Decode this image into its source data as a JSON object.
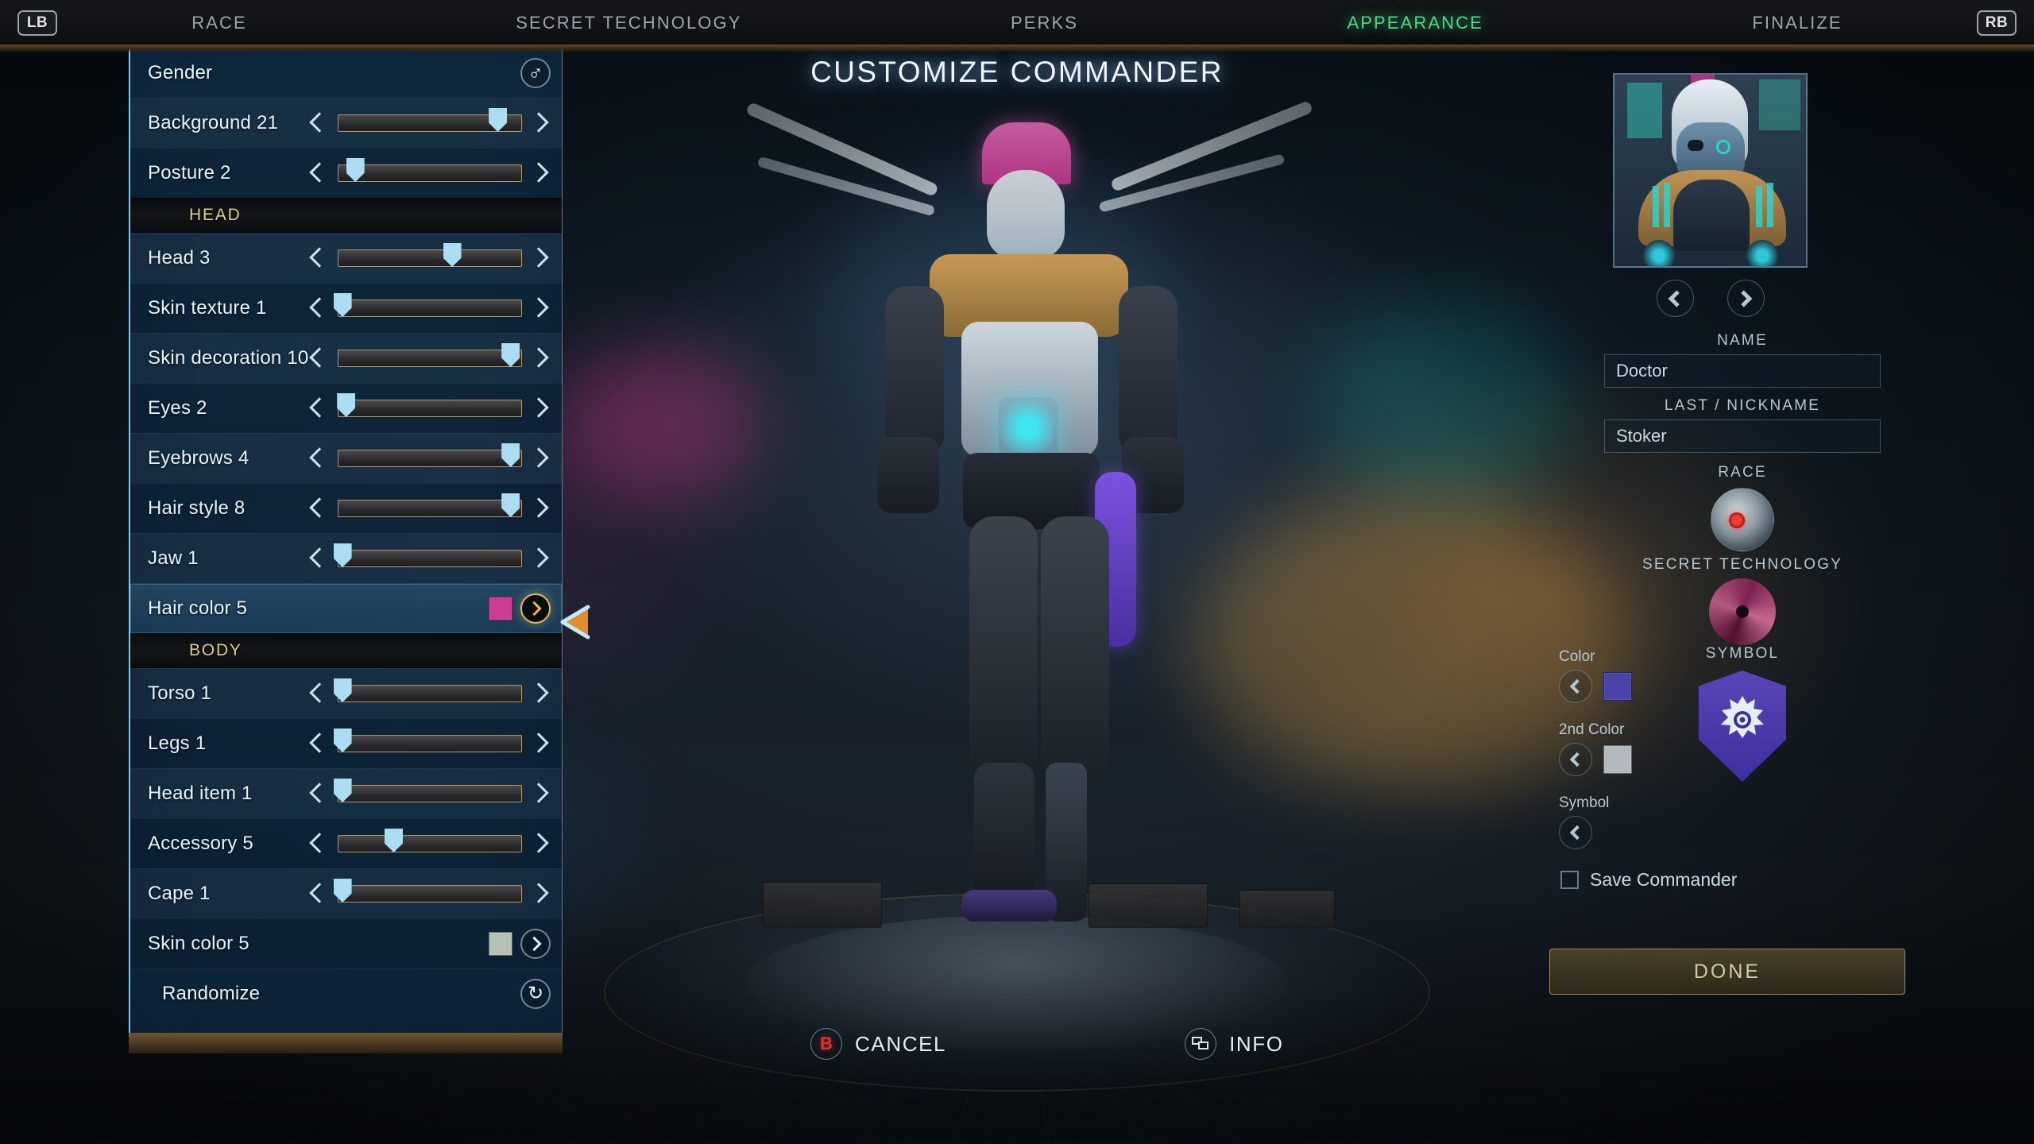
{
  "topbar": {
    "left_bumper": "LB",
    "right_bumper": "RB",
    "tabs": [
      {
        "label": "RACE",
        "active": false
      },
      {
        "label": "SECRET TECHNOLOGY",
        "active": false
      },
      {
        "label": "PERKS",
        "active": false
      },
      {
        "label": "APPEARANCE",
        "active": true
      },
      {
        "label": "FINALIZE",
        "active": false
      }
    ],
    "active_tab_color": "#4fd98a"
  },
  "page_title": "CUSTOMIZE COMMANDER",
  "sidebar": {
    "gender_row": {
      "label": "Gender",
      "icon": "male-gender-icon",
      "glyph": "♂"
    },
    "rows": [
      {
        "label": "Background 21",
        "type": "slider",
        "value": 0.87
      },
      {
        "label": "Posture 2",
        "type": "slider",
        "value": 0.09
      },
      {
        "label": "HEAD",
        "type": "section"
      },
      {
        "label": "Head 3",
        "type": "slider",
        "value": 0.62
      },
      {
        "label": "Skin texture 1",
        "type": "slider",
        "value": 0.02
      },
      {
        "label": "Skin decoration 10",
        "type": "slider",
        "value": 0.94
      },
      {
        "label": "Eyes 2",
        "type": "slider",
        "value": 0.04
      },
      {
        "label": "Eyebrows 4",
        "type": "slider",
        "value": 0.94
      },
      {
        "label": "Hair style 8",
        "type": "slider",
        "value": 0.94
      },
      {
        "label": "Jaw 1",
        "type": "slider",
        "value": 0.02
      },
      {
        "label": "Hair color 5",
        "type": "color",
        "color": "#cc3d93",
        "selected": true
      },
      {
        "label": "BODY",
        "type": "section"
      },
      {
        "label": "Torso 1",
        "type": "slider",
        "value": 0.02
      },
      {
        "label": "Legs 1",
        "type": "slider",
        "value": 0.02
      },
      {
        "label": "Head item 1",
        "type": "slider",
        "value": 0.02
      },
      {
        "label": "Accessory 5",
        "type": "slider",
        "value": 0.3
      },
      {
        "label": "Cape 1",
        "type": "slider",
        "value": 0.02
      },
      {
        "label": "Skin color 5",
        "type": "color",
        "color": "#b8c2b4"
      }
    ],
    "randomize": {
      "label": "Randomize",
      "icon": "recycle-icon",
      "glyph": "↻"
    }
  },
  "right_panel": {
    "portrait_alt": "commander-portrait",
    "prev_label": "‹",
    "next_label": "›",
    "name": {
      "label": "NAME",
      "value": "Doctor"
    },
    "nickname": {
      "label": "LAST / NICKNAME",
      "value": "Stoker"
    },
    "race": {
      "label": "RACE"
    },
    "secret_technology": {
      "label": "SECRET TECHNOLOGY"
    },
    "symbol": {
      "label": "SYMBOL"
    },
    "color": {
      "label": "Color",
      "value": "#4a43a8"
    },
    "color2": {
      "label": "2nd Color",
      "value": "#b3b9bf"
    },
    "symbol_select": {
      "label": "Symbol"
    },
    "save_commander": {
      "label": "Save Commander",
      "checked": false
    },
    "done_button": "DONE"
  },
  "bottom_actions": [
    {
      "label": "CANCEL",
      "button": "B",
      "icon": "b-button-icon"
    },
    {
      "label": "INFO",
      "button": "",
      "icon": "window-panel-icon"
    }
  ],
  "colors": {
    "accent_green": "#4fd98a",
    "panel_blue": "#122d44",
    "section_gold": "#dfce86",
    "knob_blue": "#aadcf2",
    "gold_border": "#c4aa74"
  }
}
